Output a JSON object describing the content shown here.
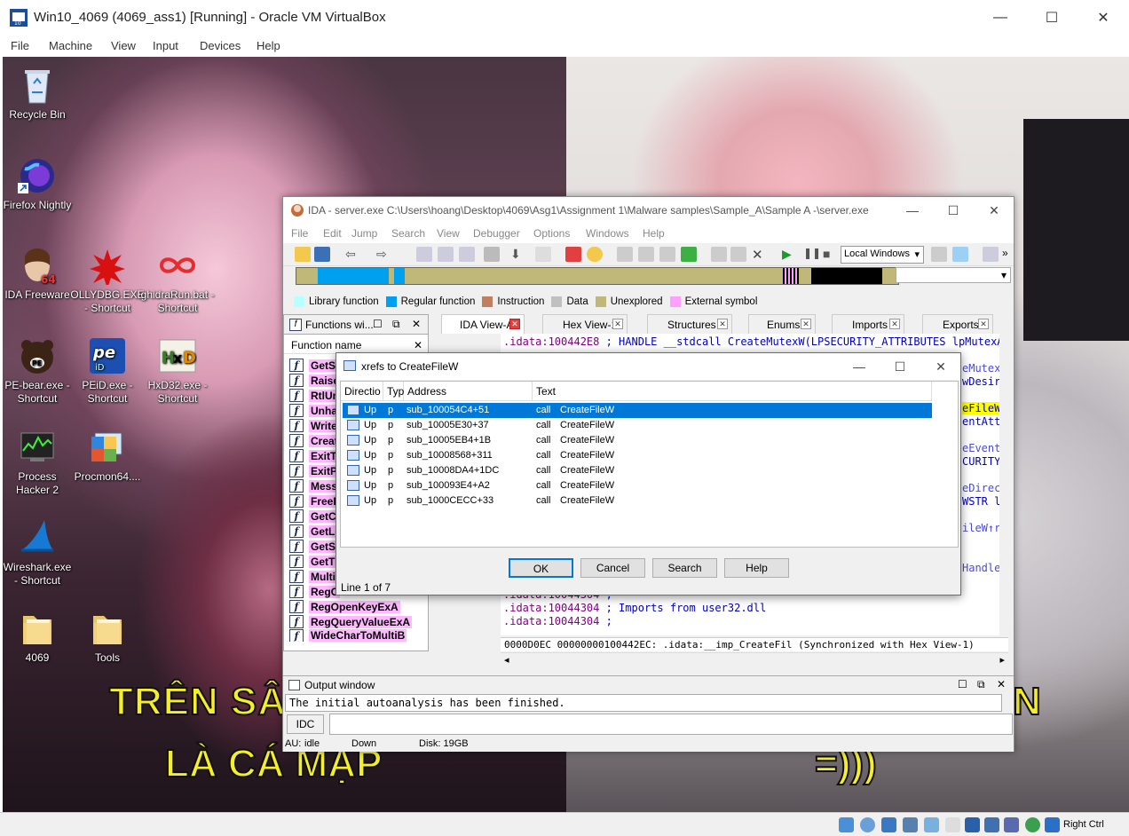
{
  "vbox": {
    "title": "Win10_4069 (4069_ass1) [Running] - Oracle VM VirtualBox",
    "menu": [
      "File",
      "Machine",
      "View",
      "Input",
      "Devices",
      "Help"
    ],
    "status_right": "Right Ctrl"
  },
  "desktop": {
    "icons": [
      {
        "label": "Recycle Bin"
      },
      {
        "label": "Firefox Nightly"
      },
      {
        "label": "IDA Freeware"
      },
      {
        "label": "OLLYDBG.EXE - Shortcut"
      },
      {
        "label": "ghidraRun.bat - Shortcut"
      },
      {
        "label": "PE-bear.exe - Shortcut"
      },
      {
        "label": "PEiD.exe - Shortcut"
      },
      {
        "label": "HxD32.exe - Shortcut"
      },
      {
        "label": "Process Hacker 2"
      },
      {
        "label": "Procmon64...."
      },
      {
        "label": "Wireshark.exe - Shortcut"
      },
      {
        "label": "4069"
      },
      {
        "label": "Tools"
      }
    ],
    "caption_line1": "TRÊN SÂ",
    "caption_line1_right": "N",
    "caption_line2": "LÀ CÁ MẬP",
    "caption_line2_right": "=)))"
  },
  "ida": {
    "title": "IDA - server.exe C:\\Users\\hoang\\Desktop\\4069\\Asg1\\Assignment 1\\Malware samples\\Sample_A\\Sample A -\\server.exe",
    "menu": [
      "File",
      "Edit",
      "Jump",
      "Search",
      "View",
      "Debugger",
      "Options",
      "Windows",
      "Help"
    ],
    "debugger_select": "Local Windows",
    "legend": [
      {
        "label": "Library function",
        "color": "#b8ffff"
      },
      {
        "label": "Regular function",
        "color": "#00a0f0"
      },
      {
        "label": "Instruction",
        "color": "#c08060"
      },
      {
        "label": "Data",
        "color": "#c0c0c0"
      },
      {
        "label": "Unexplored",
        "color": "#c0b878"
      },
      {
        "label": "External symbol",
        "color": "#ffa0ff"
      }
    ],
    "functions_title": "Functions wi...",
    "functions_col": "Function name",
    "functions": [
      "GetSt",
      "Raise",
      "RtlUn",
      "Unha",
      "Write",
      "Creat",
      "ExitT",
      "ExitP",
      "Mess",
      "FreeL",
      "GetCo",
      "GetLo",
      "GetSt",
      "GetTi",
      "Multi",
      "RegC",
      "RegOpenKeyExA",
      "RegQueryValueExA",
      "WideCharToMultiB"
    ],
    "tabs": [
      {
        "label": "IDA View-A",
        "active": true
      },
      {
        "label": "Hex View-1"
      },
      {
        "label": "Structures"
      },
      {
        "label": "Enums"
      },
      {
        "label": "Imports"
      },
      {
        "label": "Exports"
      }
    ],
    "code_top": {
      "addr": ".idata:100442E8",
      "text": " ; HANDLE __stdcall CreateMutexW(LPSECURITY_ATTRIBUTES lpMutexAtt"
    },
    "code_right": [
      "eMutex",
      "wDesir",
      "eFileW",
      "entAtt",
      "eEvent",
      "CURITY",
      "eDirec",
      "WSTR l",
      "ileW↑r",
      "Handle"
    ],
    "code_bottom": [
      {
        "addr": ".idata:10044304",
        "text": " ;"
      },
      {
        "addr": ".idata:10044304",
        "text": " ; Imports from user32.dll"
      },
      {
        "addr": ".idata:10044304",
        "text": " ;"
      }
    ],
    "code_status": "0000D0EC 00000000100442EC: .idata:__imp_CreateFil (Synchronized with Hex View-1)",
    "output_title": "Output window",
    "output_text": "The initial autoanalysis has been finished.",
    "idc_label": "IDC",
    "status": {
      "au": "AU:",
      "state": "idle",
      "dir": "Down",
      "disk": "Disk: 19GB"
    }
  },
  "xrefs": {
    "title": "xrefs to CreateFileW",
    "columns": [
      "Directio",
      "Typ",
      "Address",
      "Text"
    ],
    "rows": [
      {
        "dir": "Up",
        "type": "p",
        "addr": "sub_100054C4+51",
        "op": "call",
        "target": "CreateFileW"
      },
      {
        "dir": "Up",
        "type": "p",
        "addr": "sub_10005E30+37",
        "op": "call",
        "target": "CreateFileW"
      },
      {
        "dir": "Up",
        "type": "p",
        "addr": "sub_10005EB4+1B",
        "op": "call",
        "target": "CreateFileW"
      },
      {
        "dir": "Up",
        "type": "p",
        "addr": "sub_10008568+311",
        "op": "call",
        "target": "CreateFileW"
      },
      {
        "dir": "Up",
        "type": "p",
        "addr": "sub_10008DA4+1DC",
        "op": "call",
        "target": "CreateFileW"
      },
      {
        "dir": "Up",
        "type": "p",
        "addr": "sub_100093E4+A2",
        "op": "call",
        "target": "CreateFileW"
      },
      {
        "dir": "Up",
        "type": "p",
        "addr": "sub_1000CECC+33",
        "op": "call",
        "target": "CreateFileW"
      }
    ],
    "buttons": {
      "ok": "OK",
      "cancel": "Cancel",
      "search": "Search",
      "help": "Help"
    },
    "status": "Line 1 of 7"
  }
}
